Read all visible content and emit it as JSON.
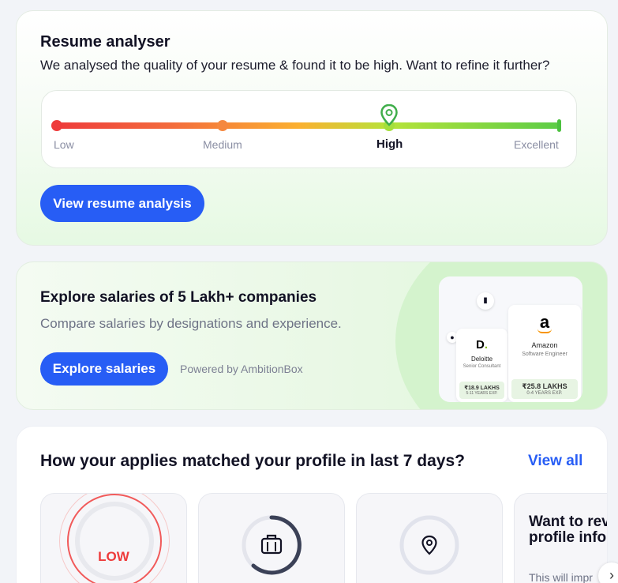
{
  "resume_analyser": {
    "title": "Resume analyser",
    "subtitle": "We analysed the quality of your resume & found it to be high. Want to refine it further?",
    "levels": [
      "Low",
      "Medium",
      "High",
      "Excellent"
    ],
    "current_level": "High",
    "button_label": "View resume analysis",
    "colors": {
      "low": "#ee3b3b",
      "high": "#5bcc46",
      "pin": "#3fae4a"
    }
  },
  "salaries": {
    "title": "Explore salaries of 5 Lakh+ companies",
    "subtitle": "Compare salaries by designations and experience.",
    "button_label": "Explore salaries",
    "powered_by": "Powered by AmbitionBox",
    "companies": [
      {
        "name": "Deloitte",
        "role": "Senior Consultant",
        "salary": "₹18.9 LAKHS",
        "exp": "5-11 YEARS EXP.",
        "logo": "D."
      },
      {
        "name": "Amazon",
        "role": "Software Engineer",
        "salary": "₹25.8 LAKHS",
        "exp": "0-4 YEARS EXP.",
        "logo": "a"
      }
    ]
  },
  "applies": {
    "title": "How your applies matched your profile in last 7 days?",
    "view_all": "View all",
    "tiles": [
      {
        "label": "LOW",
        "icon": "gauge-icon"
      },
      {
        "icon": "briefcase-icon"
      },
      {
        "icon": "location-pin-icon"
      },
      {
        "question": "Want to rev your profile information",
        "hint": "This will impr"
      }
    ],
    "next_icon": "›"
  },
  "brand_color": "#275df5"
}
